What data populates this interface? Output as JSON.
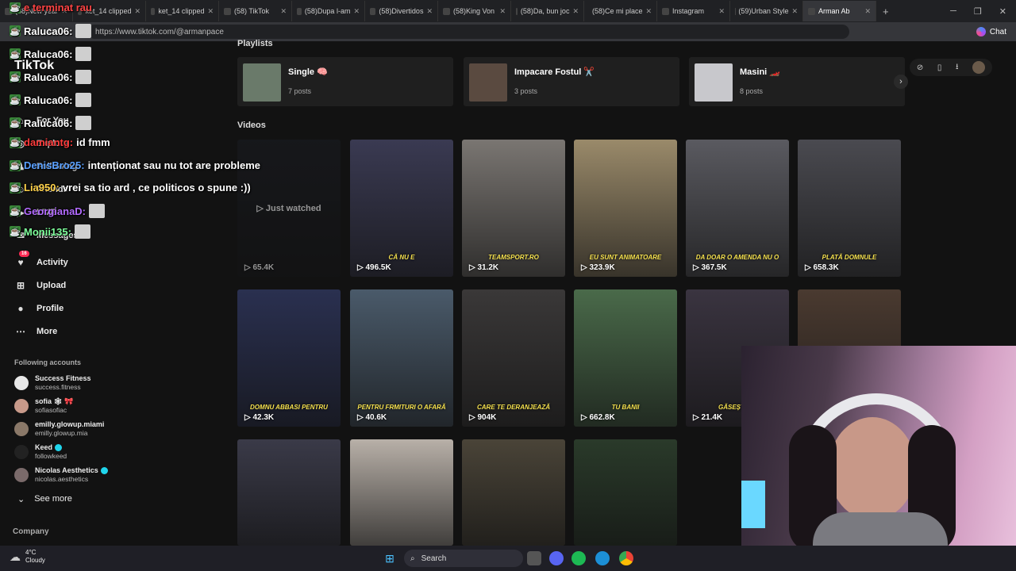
{
  "browser": {
    "tabs": [
      {
        "label": "(58)New year"
      },
      {
        "label": "ket_14 clipped"
      },
      {
        "label": "ket_14 clipped"
      },
      {
        "label": "(58) TikTok"
      },
      {
        "label": "(58)Dupa l-am"
      },
      {
        "label": "(58)Divertidos"
      },
      {
        "label": "(58)King Von"
      },
      {
        "label": "(58)Da, bun joc"
      },
      {
        "label": "(58)Ce mi place"
      },
      {
        "label": "Instagram"
      },
      {
        "label": "(59)Urban Style"
      },
      {
        "label": "Arman Ab"
      }
    ],
    "url": "https://www.tiktok.com/@armanpace",
    "chat_label": "Chat"
  },
  "sidebar": {
    "logo": "TikTok",
    "nav": [
      {
        "label": "For You",
        "icon": "home-icon"
      },
      {
        "label": "Explore",
        "icon": "compass-icon"
      },
      {
        "label": "Following",
        "icon": "following-icon"
      },
      {
        "label": "Friends",
        "icon": "friends-icon"
      },
      {
        "label": "LIVE",
        "icon": "live-icon"
      },
      {
        "label": "Messages",
        "icon": "messages-icon"
      },
      {
        "label": "Activity",
        "icon": "activity-icon",
        "badge": "16"
      },
      {
        "label": "Upload",
        "icon": "upload-icon"
      },
      {
        "label": "Profile",
        "icon": "profile-icon"
      },
      {
        "label": "More",
        "icon": "more-icon"
      }
    ],
    "following_title": "Following accounts",
    "accounts": [
      {
        "name": "Success Fitness",
        "handle": "success.fitness",
        "verified": false,
        "color": "#e8e8e8"
      },
      {
        "name": "sofia 🕸 🎀",
        "handle": "sofiasofiac",
        "verified": false,
        "color": "#c89a8a"
      },
      {
        "name": "emilly.glowup.miami",
        "handle": "emilly.glowup.mia",
        "verified": false,
        "color": "#8a7868"
      },
      {
        "name": "Keed",
        "handle": "followkeed",
        "verified": true,
        "color": "#222222"
      },
      {
        "name": "Nicolas Aesthetics",
        "handle": "nicolas.aesthetics",
        "verified": true,
        "color": "#7a6a6a"
      }
    ],
    "see_more": "See more",
    "company": "Company"
  },
  "main": {
    "playlists_title": "Playlists",
    "playlists": [
      {
        "name": "Single 🧠",
        "count": "7 posts",
        "color": "#6a7a6a"
      },
      {
        "name": "Impacare Fostul ✂️",
        "count": "3 posts",
        "color": "#5a4a40"
      },
      {
        "name": "Masini 🏎️",
        "count": "8 posts",
        "color": "#c8c8cc"
      }
    ],
    "videos_title": "Videos",
    "just_watched": "▷ Just watched",
    "videos": [
      {
        "views": "65.4K",
        "caption": "",
        "color": "#1a1c22"
      },
      {
        "views": "496.5K",
        "caption": "CĂ NU E",
        "color": "#3a3a52"
      },
      {
        "views": "31.2K",
        "caption": "TEAMSPORT.RO",
        "color": "#7a7672"
      },
      {
        "views": "323.9K",
        "caption": "EU SUNT ANIMATOARE",
        "color": "#9a8a6a"
      },
      {
        "views": "367.5K",
        "caption": "DA DOAR O AMENDA NU O",
        "color": "#5a5a60"
      },
      {
        "views": "658.3K",
        "caption": "PLATĂ DOMNULE",
        "color": "#4a4a50"
      },
      {
        "views": "42.3K",
        "caption": "DOMNU ABBASI PENTRU",
        "color": "#2a3050"
      },
      {
        "views": "40.6K",
        "caption": "PENTRU FRMITURI O AFARĂ",
        "color": "#4a5a6a"
      },
      {
        "views": "904K",
        "caption": "CARE TE DERANJEAZĂ",
        "color": "#3a3838"
      },
      {
        "views": "662.8K",
        "caption": "TU BANII",
        "color": "#4a6a4a"
      },
      {
        "views": "21.4K",
        "caption": "GĂSEȘTI LA",
        "color": "#3a3440"
      },
      {
        "views": "",
        "caption": "",
        "color": "#4a3a30"
      },
      {
        "views": "",
        "caption": "",
        "color": "#3a3a48"
      },
      {
        "views": "",
        "caption": "",
        "color": "#b8b0a8"
      },
      {
        "views": "",
        "caption": "",
        "color": "#4a4438"
      },
      {
        "views": "",
        "caption": "",
        "color": "#2a3a2a"
      }
    ]
  },
  "chat_overlay": [
    {
      "user": "",
      "message": "e terminat rau",
      "user_color": "#ff4444"
    },
    {
      "user": "Raluca06:",
      "message": "",
      "user_color": "#ffffff"
    },
    {
      "user": "Raluca06:",
      "message": "",
      "user_color": "#ffffff"
    },
    {
      "user": "Raluca06:",
      "message": "",
      "user_color": "#ffffff"
    },
    {
      "user": "Raluca06:",
      "message": "",
      "user_color": "#ffffff"
    },
    {
      "user": "Raluca06:",
      "message": "",
      "user_color": "#ffffff"
    },
    {
      "user": "damiantg:",
      "message": "id fmm",
      "user_color": "#ff3b3b"
    },
    {
      "user": "DenisBro25:",
      "message": "intenționat sau nu tot are probleme",
      "user_color": "#5aa0ff"
    },
    {
      "user": "Lia950:",
      "message": "vrei sa tio ard , ce politicos o spune :))",
      "user_color": "#ffd24a"
    },
    {
      "user": "GeorgianaD:",
      "message": "",
      "user_color": "#b36bff"
    },
    {
      "user": "Monii135:",
      "message": "",
      "user_color": "#7dff9a"
    }
  ],
  "taskbar": {
    "temp": "4°C",
    "weather": "Cloudy",
    "search": "Search"
  }
}
